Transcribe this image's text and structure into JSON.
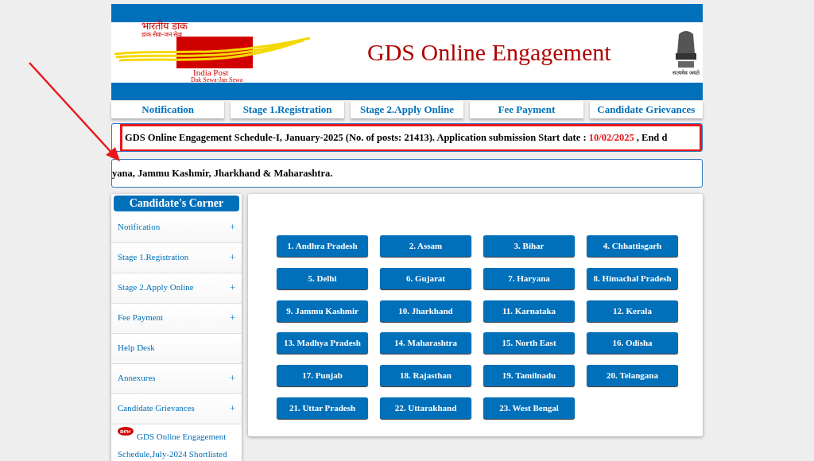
{
  "header": {
    "logo": {
      "hindi_title": "भारतीय डाक",
      "hindi_tagline": "डाक सेवा-जन सेवा",
      "name": "India Post",
      "tagline": "Dak Sewa-Jan Sewa"
    },
    "title": "GDS Online Engagement",
    "emblem_motto": "सत्यमेव जयते"
  },
  "nav": [
    {
      "label": "Notification"
    },
    {
      "label": "Stage 1.Registration"
    },
    {
      "label": "Stage 2.Apply Online"
    },
    {
      "label": "Fee Payment"
    },
    {
      "label": "Candidate Grievances"
    }
  ],
  "ticker": {
    "before": "GDS Online Engagement Schedule-I, January-2025 (No. of posts: 21413). Application submission Start date : ",
    "date": "10/02/2025",
    "after": " , End d",
    "highlighted": true
  },
  "ticker_2": "yana, Jammu Kashmir, Jharkhand & Maharashtra.",
  "sidebar": {
    "title": "Candidate's Corner",
    "items": [
      {
        "label": "Notification",
        "toggle": "+"
      },
      {
        "label": "Stage 1.Registration",
        "toggle": "+"
      },
      {
        "label": "Stage 2.Apply Online",
        "toggle": "+"
      },
      {
        "label": "Fee Payment",
        "toggle": "+"
      },
      {
        "label": "Help Desk"
      },
      {
        "label": "Annexures",
        "toggle": "+"
      },
      {
        "label": "Candidate Grievances",
        "toggle": "+"
      }
    ],
    "news": {
      "badge": "new",
      "text": "GDS Online Engagement Schedule,July-2024 Shortlisted"
    }
  },
  "states": [
    "1. Andhra Pradesh",
    "2. Assam",
    "3. Bihar",
    "4. Chhattisgarh",
    "5. Delhi",
    "6. Gujarat",
    "7. Haryana",
    "8. Himachal Pradesh",
    "9. Jammu Kashmir",
    "10. Jharkhand",
    "11. Karnataka",
    "12. Kerala",
    "13. Madhya Pradesh",
    "14. Maharashtra",
    "15. North East",
    "16. Odisha",
    "17. Punjab",
    "18. Rajasthan",
    "19. Tamilnadu",
    "20. Telangana",
    "21. Uttar Pradesh",
    "22. Uttarakhand",
    "23. West Bengal"
  ]
}
